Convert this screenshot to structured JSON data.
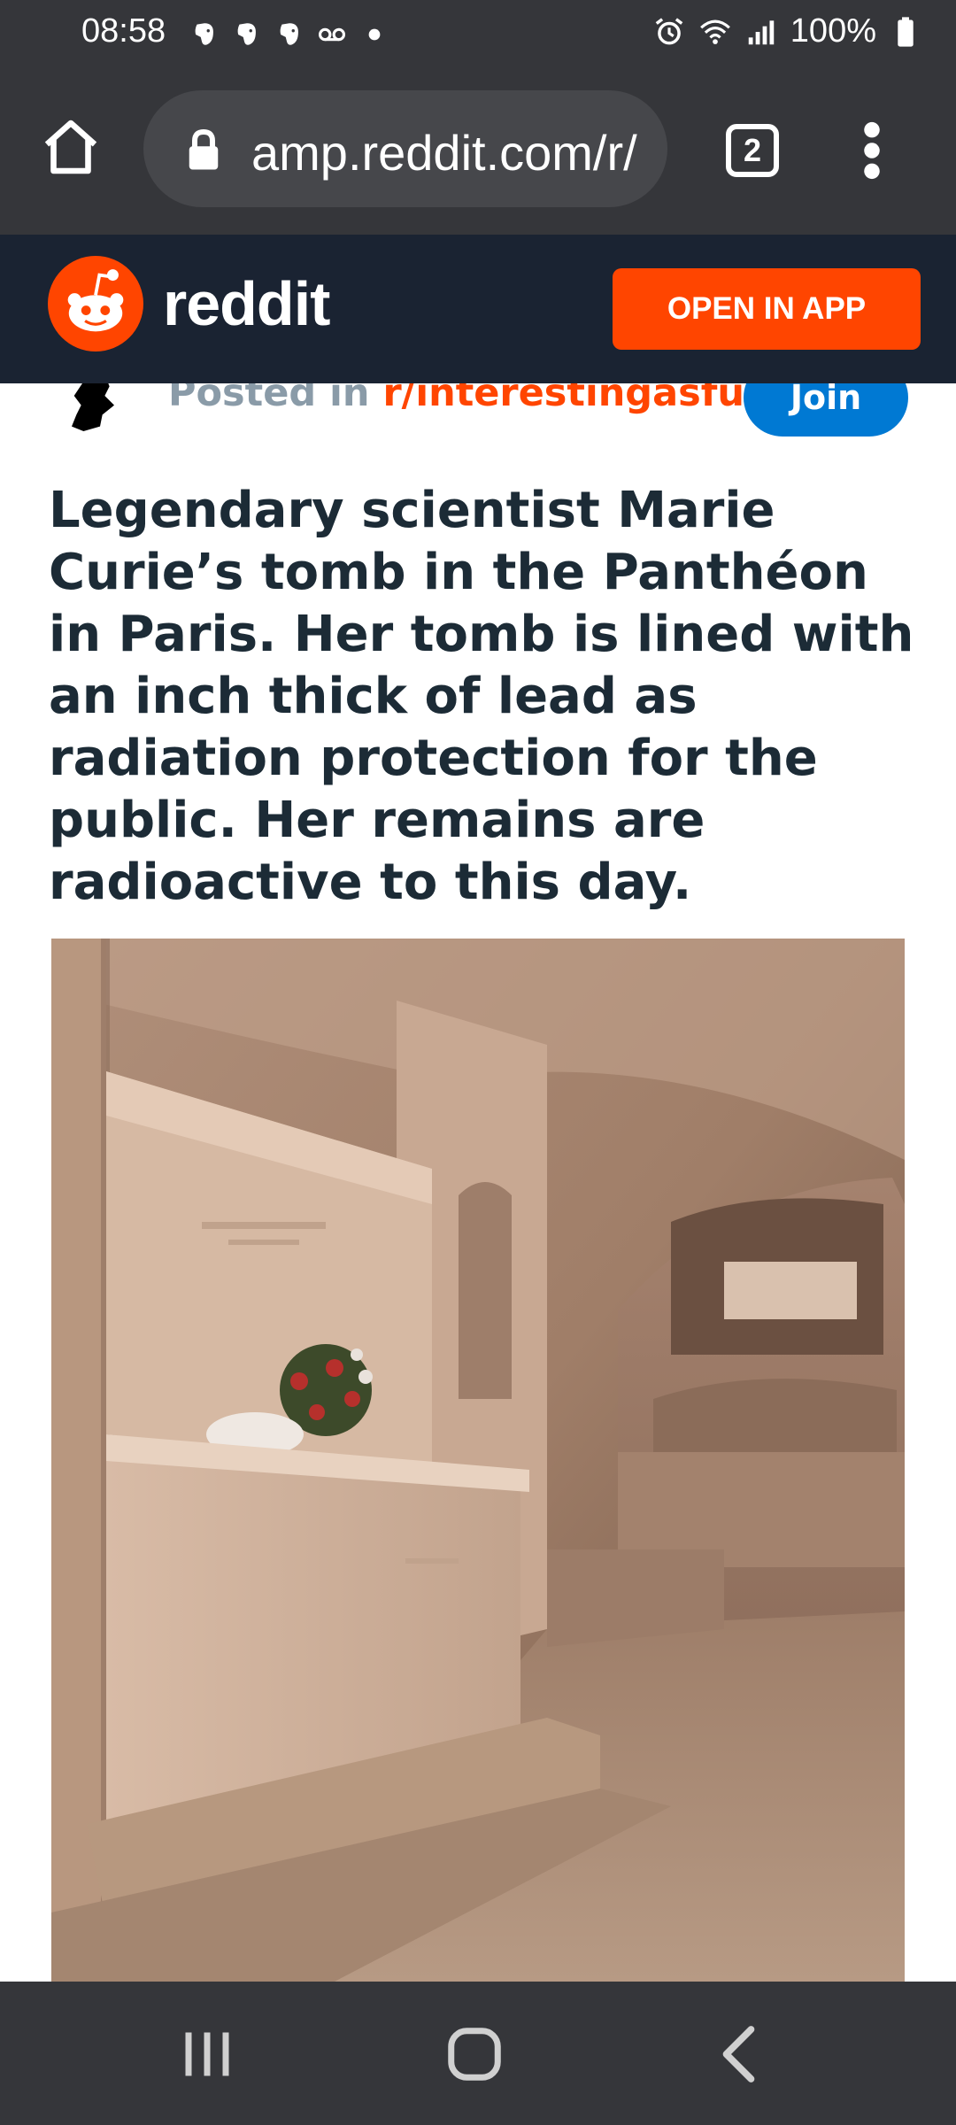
{
  "status_bar": {
    "time": "08:58",
    "battery": "100%",
    "left_icons": [
      "evernote-icon",
      "evernote-icon",
      "evernote-icon",
      "voicemail-icon",
      "dot-icon"
    ],
    "right_icons": [
      "alarm-icon",
      "wifi-icon",
      "signal-icon",
      "battery-icon"
    ]
  },
  "browser": {
    "url": "amp.reddit.com/r/",
    "tab_count": "2"
  },
  "reddit_header": {
    "wordmark": "reddit",
    "open_in_app_label": "OPEN IN APP",
    "brand_color": "#ff4500",
    "header_bg": "#1a2332"
  },
  "post": {
    "posted_in_label": "Posted in ",
    "subreddit": "r/interestingasfuck",
    "join_label": "Join",
    "title": "Legendary scientist Marie Curie’s tomb in the Panthéon in Paris. Her tomb is lined with an inch thick of lead as radiation protection for the public. Her remains are radioactive to this day."
  },
  "nav_bar": {
    "buttons": [
      "recent-apps-icon",
      "home-icon",
      "back-icon"
    ]
  }
}
